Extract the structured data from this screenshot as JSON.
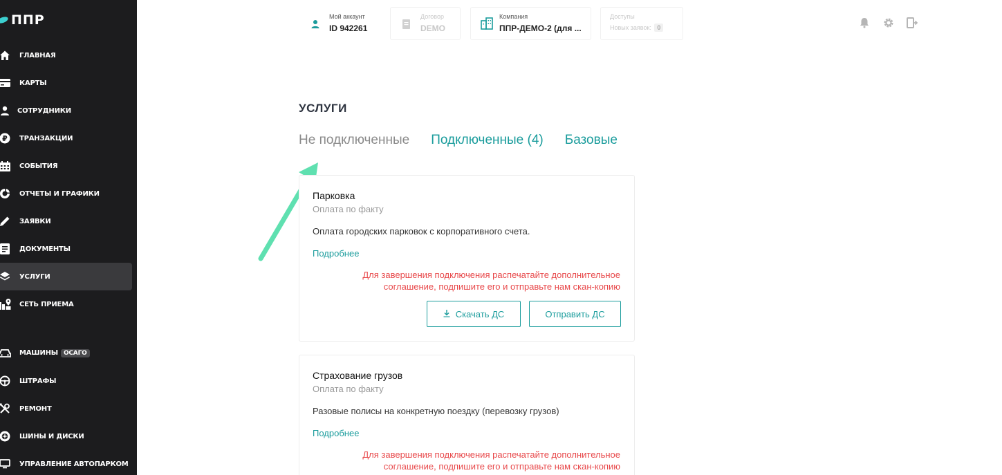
{
  "brand": {
    "name": "ППР"
  },
  "sidebar": {
    "items": [
      {
        "label": "ГЛАВНАЯ",
        "icon": "home-icon"
      },
      {
        "label": "КАРТЫ",
        "icon": "card-icon"
      },
      {
        "label": "СОТРУДНИКИ",
        "icon": "user-icon"
      },
      {
        "label": "ТРАНЗАКЦИИ",
        "icon": "ruble-icon"
      },
      {
        "label": "СОБЫТИЯ",
        "icon": "calendar-icon"
      },
      {
        "label": "ОТЧЕТЫ И ГРАФИКИ",
        "icon": "chart-icon"
      },
      {
        "label": "ЗАЯВКИ",
        "icon": "pencil-icon"
      },
      {
        "label": "ДОКУМЕНТЫ",
        "icon": "document-icon"
      },
      {
        "label": "УСЛУГИ",
        "icon": "layers-icon",
        "active": true
      },
      {
        "label": "СЕТЬ ПРИЕМА",
        "icon": "map-pin-icon"
      },
      {
        "label": "МАШИНЫ",
        "icon": "car-icon",
        "badge": "ОСАГО"
      },
      {
        "label": "ШТРАФЫ",
        "icon": "steering-wheel-icon"
      },
      {
        "label": "РЕМОНТ",
        "icon": "tools-icon"
      },
      {
        "label": "ШИНЫ И ДИСКИ",
        "icon": "tire-icon"
      },
      {
        "label": "УПРАВЛЕНИЕ АВТОПАРКОМ",
        "icon": "monitor-icon"
      }
    ]
  },
  "header": {
    "account": {
      "caption": "Мой аккаунт",
      "value": "ID 942261"
    },
    "contract": {
      "caption": "Договор",
      "value": "DEMO"
    },
    "company": {
      "caption": "Компания",
      "value": "ППР-ДЕМО-2 (для ..."
    },
    "access": {
      "caption": "Доступы",
      "value_label": "Новых заявок:",
      "count": "0"
    }
  },
  "main": {
    "title": "УСЛУГИ",
    "tabs": [
      {
        "label": "Не подключенные",
        "active": true
      },
      {
        "label": "Подключенные (4)",
        "active": false
      },
      {
        "label": "Базовые",
        "active": false
      }
    ],
    "cards": [
      {
        "title": "Парковка",
        "payment": "Оплата по факту",
        "description": "Оплата городских парковок с корпоративного счета.",
        "more": "Подробнее",
        "warning_line1": "Для завершения подключения распечатайте дополнительное",
        "warning_line2": "соглашение, подпишите его и отправьте нам скан-копию",
        "download_label": "Скачать ДС",
        "send_label": "Отправить ДС"
      },
      {
        "title": "Страхование грузов",
        "payment": "Оплата по факту",
        "description": "Разовые полисы на конкретную поездку (перевозку грузов)",
        "more": "Подробнее",
        "warning_line1": "Для завершения подключения распечатайте дополнительное",
        "warning_line2": "соглашение, подпишите его и отправьте нам скан-копию"
      }
    ]
  },
  "colors": {
    "accent": "#1a9c9c",
    "warning": "#e8484a",
    "sidebar": "#1c1c1e",
    "arrow": "#5fe0b0"
  }
}
